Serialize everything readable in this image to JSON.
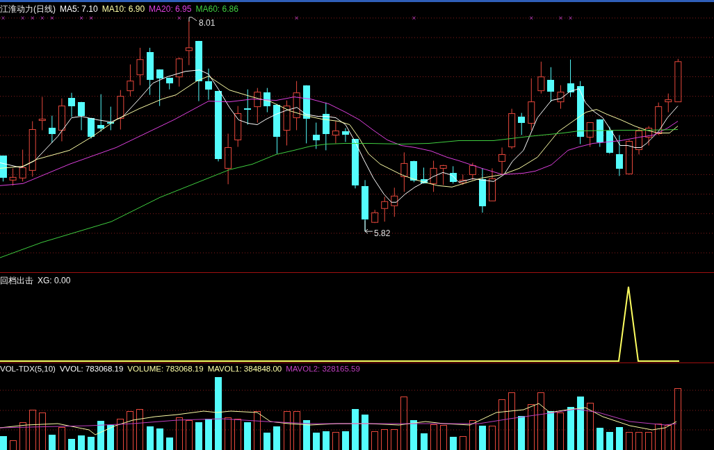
{
  "price_panel": {
    "title": "江淮动力(日线)",
    "indicators": [
      {
        "label": "MA5: 7.10",
        "color": "#ffffff"
      },
      {
        "label": "MA10: 6.90",
        "color": "#ffffa8"
      },
      {
        "label": "MA20: 6.95",
        "color": "#e040e0"
      },
      {
        "label": "MA60: 6.86",
        "color": "#40d040"
      }
    ],
    "high_label": "8.01",
    "low_label": "5.82"
  },
  "signal_panel": {
    "title": "回档出击",
    "reading": "XG: 0.00"
  },
  "volume_panel": {
    "title": "VOL-TDX(5,10)",
    "readings": [
      {
        "label": "VVOL: 783068.19",
        "color": "#ffffff"
      },
      {
        "label": "VOLUME: 783068.19",
        "color": "#ffffa8"
      },
      {
        "label": "MAVOL1: 384848.00",
        "color": "#ffffa8"
      },
      {
        "label": "MAVOL2: 328165.59",
        "color": "#c040c0"
      }
    ]
  }
}
